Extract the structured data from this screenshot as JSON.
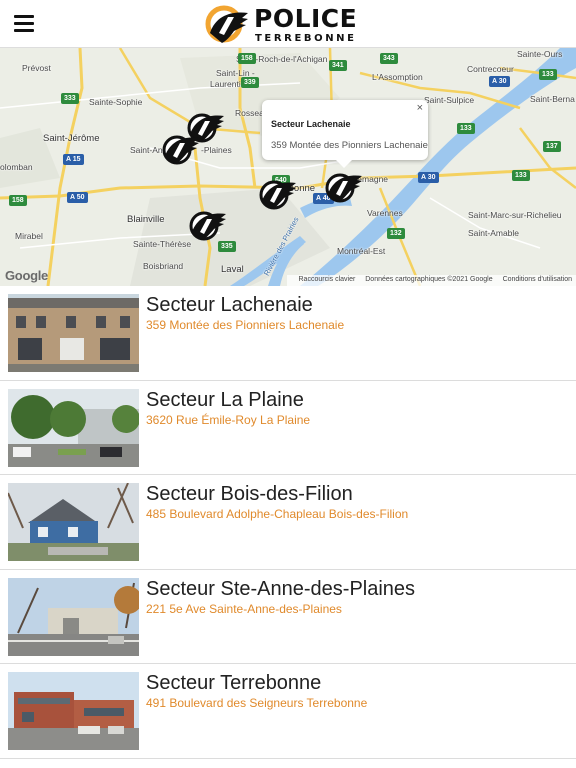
{
  "header": {
    "menu_icon": "hamburger-icon",
    "logo_word": "POLICE",
    "logo_sub": "TERREBONNE"
  },
  "map": {
    "popup": {
      "title": "Secteur Lachenaie",
      "address": "359 Montée des Pionniers Lachenaie",
      "close": "×"
    },
    "labels": {
      "prevost": "Prévost",
      "saint_lin": "Saint-Lin -",
      "laurentides": "Laurentides",
      "lassomption": "L'Assomption",
      "sainte_sophie": "Sainte-Sophie",
      "saint_jerome": "Saint-Jérôme",
      "saint_anne": "Saint-Anne-",
      "des_plaines": "-Plaines",
      "rosseau": "Rosseau-d...",
      "terrebonne": "Terrebonne",
      "charlemagne": "Charlemagne",
      "blainville": "Blainville",
      "mirabel": "Mirabel",
      "sainte_therese": "Sainte-Thérèse",
      "boisbriand": "Boisbriand",
      "laval": "Laval",
      "varennes": "Varennes",
      "montreal_est": "Montréal-Est",
      "saint_sulpice": "Saint-Sulpice",
      "contrecoeur": "Contrecoeur",
      "saint_roch": "Saint-Roch-de-l'Achigan",
      "sainte_ours": "Sainte-Ours",
      "saint_berna": "Saint-Berna",
      "saint_marc": "Saint-Marc-sur-Richelieu",
      "saint_amable": "Saint-Amable",
      "colombian": "olomban",
      "riviere": "Rivière des Prairies"
    },
    "shields": [
      "158",
      "339",
      "341",
      "343",
      "333",
      "A 15",
      "A 50",
      "158",
      "335",
      "640",
      "A 40",
      "132",
      "A 30",
      "A 30",
      "133",
      "137",
      "133",
      "133"
    ],
    "google": "Google",
    "attribution": {
      "shortcuts": "Raccourcis clavier",
      "data": "Données cartographiques ©2021 Google",
      "terms": "Conditions d'utilisation"
    }
  },
  "stations": [
    {
      "name": "Secteur Lachenaie",
      "address": "359 Montée des Pionniers Lachenaie"
    },
    {
      "name": "Secteur La Plaine",
      "address": "3620 Rue Émile-Roy La Plaine"
    },
    {
      "name": "Secteur Bois-des-Filion",
      "address": "485 Boulevard Adolphe-Chapleau Bois-des-Filion"
    },
    {
      "name": "Secteur Ste-Anne-des-Plaines",
      "address": "221 5e Ave Sainte-Anne-des-Plaines"
    },
    {
      "name": "Secteur Terrebonne",
      "address": "491 Boulevard des Seigneurs Terrebonne"
    }
  ],
  "colors": {
    "accent_orange": "#e08a2c",
    "logo_orange": "#f2a531",
    "river_blue": "#9dc7ee",
    "highway_yellow": "#f4d160"
  }
}
